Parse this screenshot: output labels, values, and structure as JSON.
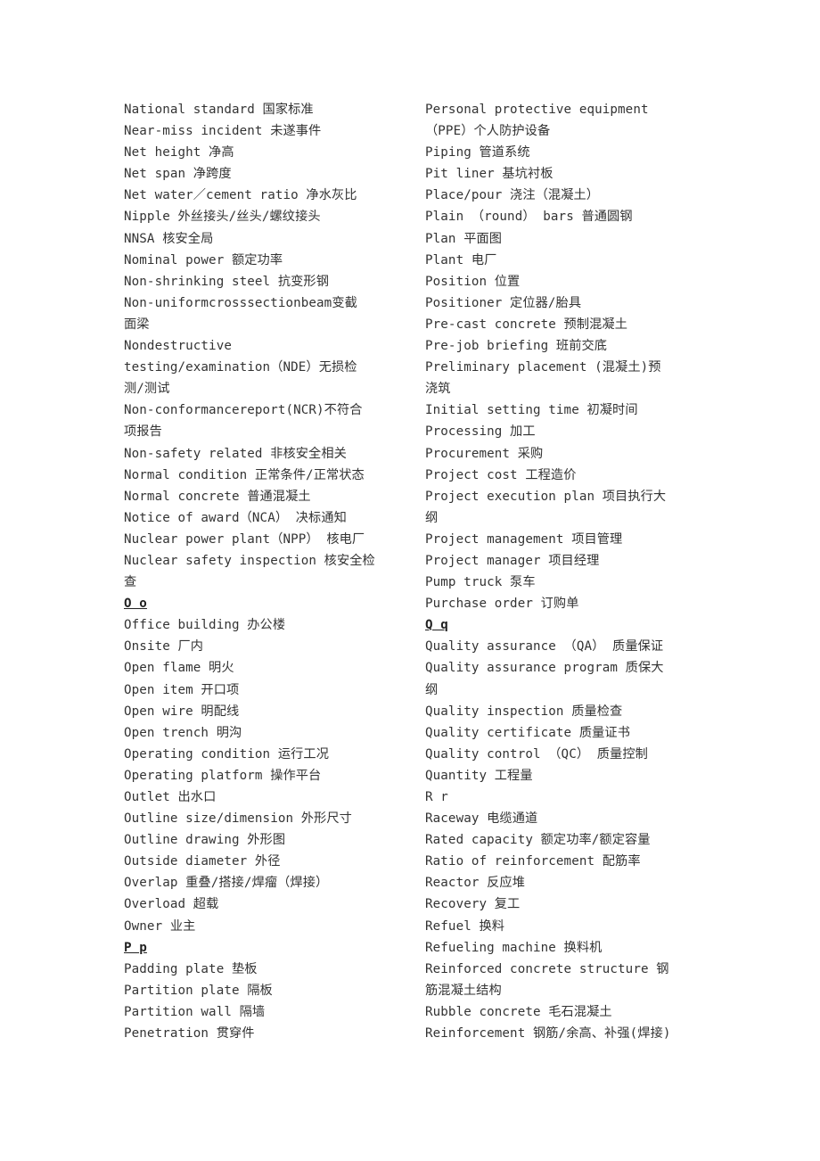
{
  "document": {
    "left_column": [
      {
        "type": "entry",
        "text": "National standard   国家标准"
      },
      {
        "type": "entry",
        "text": "Near-miss incident  未遂事件"
      },
      {
        "type": "entry",
        "text": "Net height  净高"
      },
      {
        "type": "entry",
        "text": "Net span  净跨度"
      },
      {
        "type": "entry",
        "text": "Net water／cement ratio  净水灰比"
      },
      {
        "type": "entry",
        "text": "Nipple  外丝接头/丝头/螺纹接头"
      },
      {
        "type": "entry",
        "text": "NNSA  核安全局"
      },
      {
        "type": "entry",
        "text": "Nominal power  额定功率"
      },
      {
        "type": "entry",
        "text": "Non-shrinking steel  抗变形钢"
      },
      {
        "type": "entry",
        "text": "Non-uniformcrosssectionbeam变截"
      },
      {
        "type": "continuation",
        "text": "面梁"
      },
      {
        "type": "entry",
        "text": "Nondestructive"
      },
      {
        "type": "continuation",
        "text": "testing/examination（NDE）无损检"
      },
      {
        "type": "continuation",
        "text": "测/测试"
      },
      {
        "type": "entry",
        "text": "Non-conformancereport(NCR)不符合"
      },
      {
        "type": "continuation",
        "text": "项报告"
      },
      {
        "type": "entry",
        "text": "Non-safety related  非核安全相关"
      },
      {
        "type": "entry",
        "text": "Normal condition  正常条件/正常状态"
      },
      {
        "type": "entry",
        "text": "Normal concrete  普通混凝土"
      },
      {
        "type": "entry",
        "text": "Notice of award（NCA） 决标通知"
      },
      {
        "type": "entry",
        "text": "Nuclear power plant（NPP） 核电厂"
      },
      {
        "type": "entry",
        "text": "Nuclear safety inspection 核安全检"
      },
      {
        "type": "continuation",
        "text": "查"
      },
      {
        "type": "heading",
        "text": "O o"
      },
      {
        "type": "entry",
        "text": "Office building  办公楼"
      },
      {
        "type": "entry",
        "text": "Onsite  厂内"
      },
      {
        "type": "entry",
        "text": "Open flame  明火"
      },
      {
        "type": "entry",
        "text": "Open item  开口项"
      },
      {
        "type": "entry",
        "text": "Open wire  明配线"
      },
      {
        "type": "entry",
        "text": "Open trench  明沟"
      },
      {
        "type": "entry",
        "text": "Operating condition  运行工况"
      },
      {
        "type": "entry",
        "text": "Operating platform  操作平台"
      },
      {
        "type": "entry",
        "text": "Outlet  出水口"
      },
      {
        "type": "entry",
        "text": "Outline size/dimension  外形尺寸"
      },
      {
        "type": "entry",
        "text": "Outline drawing  外形图"
      },
      {
        "type": "entry",
        "text": "Outside diameter  外径"
      },
      {
        "type": "entry",
        "text": "Overlap  重叠/搭接/焊瘤（焊接）"
      },
      {
        "type": "entry",
        "text": "Overload  超载"
      },
      {
        "type": "entry",
        "text": "Owner 业主"
      },
      {
        "type": "heading",
        "text": "P p"
      },
      {
        "type": "entry",
        "text": "Padding plate 垫板"
      },
      {
        "type": "entry",
        "text": "Partition plate  隔板"
      },
      {
        "type": "entry",
        "text": "Partition wall  隔墙"
      },
      {
        "type": "entry",
        "text": "Penetration  贯穿件"
      }
    ],
    "right_column": [
      {
        "type": "entry",
        "text": "Personal protective equipment"
      },
      {
        "type": "continuation",
        "text": "（PPE）个人防护设备"
      },
      {
        "type": "entry",
        "text": "Piping  管道系统"
      },
      {
        "type": "entry",
        "text": "Pit liner   基坑衬板"
      },
      {
        "type": "entry",
        "text": "Place/pour 浇注（混凝土）"
      },
      {
        "type": "entry",
        "text": "Plain （round） bars  普通圆钢"
      },
      {
        "type": "entry",
        "text": "Plan  平面图"
      },
      {
        "type": "entry",
        "text": "Plant  电厂"
      },
      {
        "type": "entry",
        "text": "Position  位置"
      },
      {
        "type": "entry",
        "text": "Positioner  定位器/胎具"
      },
      {
        "type": "entry",
        "text": "Pre-cast concrete  预制混凝土"
      },
      {
        "type": "entry",
        "text": "Pre-job briefing  班前交底"
      },
      {
        "type": "entry",
        "text": "Preliminary placement  (混凝土)预"
      },
      {
        "type": "continuation",
        "text": "浇筑"
      },
      {
        "type": "entry",
        "text": "Initial setting time   初凝时间"
      },
      {
        "type": "entry",
        "text": "Processing   加工"
      },
      {
        "type": "entry",
        "text": "Procurement  采购"
      },
      {
        "type": "entry",
        "text": "Project cost  工程造价"
      },
      {
        "type": "entry",
        "text": "Project execution plan  项目执行大"
      },
      {
        "type": "continuation",
        "text": "纲"
      },
      {
        "type": "entry",
        "text": "Project management  项目管理"
      },
      {
        "type": "entry",
        "text": "Project manager  项目经理"
      },
      {
        "type": "entry",
        "text": "Pump truck  泵车"
      },
      {
        "type": "entry",
        "text": "Purchase order  订购单"
      },
      {
        "type": "heading",
        "text": "Q q"
      },
      {
        "type": "entry",
        "text": "Quality assurance （QA） 质量保证"
      },
      {
        "type": "entry",
        "text": "Quality assurance program  质保大"
      },
      {
        "type": "continuation",
        "text": "纲"
      },
      {
        "type": "entry",
        "text": "Quality inspection  质量检查"
      },
      {
        "type": "entry",
        "text": "Quality certificate  质量证书"
      },
      {
        "type": "entry",
        "text": "Quality control （QC） 质量控制"
      },
      {
        "type": "entry",
        "text": "Quantity  工程量"
      },
      {
        "type": "plain-heading",
        "text": "R r"
      },
      {
        "type": "entry",
        "text": "Raceway  电缆通道"
      },
      {
        "type": "entry",
        "text": "Rated capacity  额定功率/额定容量"
      },
      {
        "type": "entry",
        "text": "Ratio of reinforcement  配筋率"
      },
      {
        "type": "entry",
        "text": "Reactor  反应堆"
      },
      {
        "type": "entry",
        "text": "Recovery  复工"
      },
      {
        "type": "entry",
        "text": "Refuel 换料"
      },
      {
        "type": "entry",
        "text": "Refueling machine  换料机"
      },
      {
        "type": "entry",
        "text": "Reinforced concrete structure  钢"
      },
      {
        "type": "continuation",
        "text": "筋混凝土结构"
      },
      {
        "type": "entry",
        "text": "Rubble concrete 毛石混凝土"
      },
      {
        "type": "entry",
        "text": "Reinforcement 钢筋/余高、补强(焊接)"
      }
    ]
  }
}
